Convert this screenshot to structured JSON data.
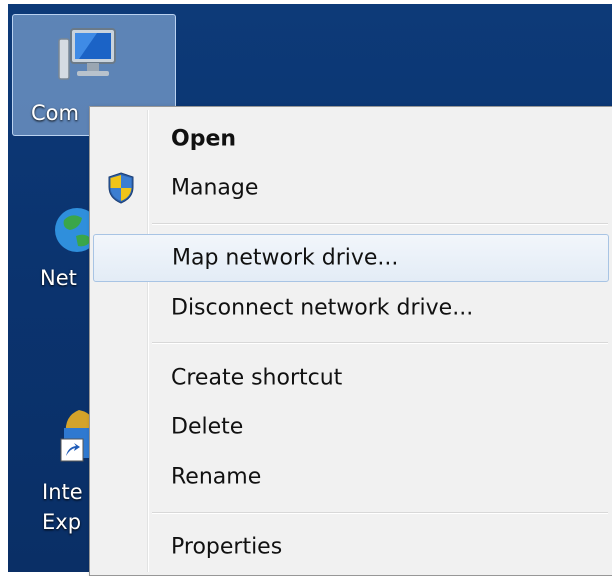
{
  "desktop": {
    "icons": [
      {
        "name": "computer",
        "label": "Com"
      },
      {
        "name": "network",
        "label": "Net"
      },
      {
        "name": "internet-explorer",
        "label_line1": "Inte",
        "label_line2": "Exp"
      }
    ]
  },
  "context_menu": {
    "items": [
      {
        "label": "Open",
        "bold": true
      },
      {
        "label": "Manage",
        "icon": "uac-shield-icon"
      },
      {
        "label": "Map network drive...",
        "highlighted": true
      },
      {
        "label": "Disconnect network drive..."
      },
      {
        "label": "Create shortcut"
      },
      {
        "label": "Delete"
      },
      {
        "label": "Rename"
      },
      {
        "label": "Properties"
      }
    ]
  }
}
